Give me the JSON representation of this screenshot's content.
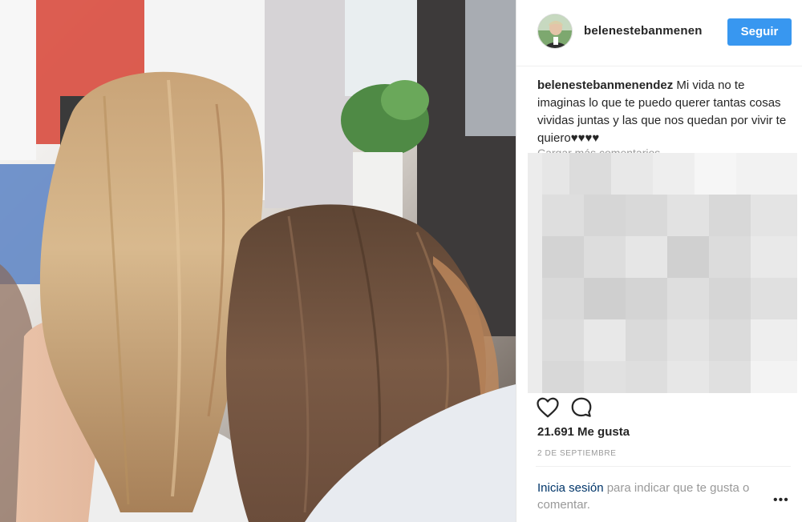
{
  "post": {
    "username": "belenestebanmenen",
    "follow_label": "Seguir",
    "caption_user": "belenestebanmenendez",
    "caption_text": " Mi vida no te imaginas lo que te puedo querer tantas cosas vividas juntas y las que nos quedan por vivir te quiero♥♥♥♥",
    "load_more_label": "Cargar más comentarios",
    "likes": "21.691 Me gusta",
    "date": "2 DE SEPTIEMBRE",
    "login_link": "Inicia sesión",
    "login_rest": " para indicar que te gusta o comentar.",
    "more_options": "•••"
  },
  "icons": {
    "like": "heart-icon",
    "comment": "comment-icon",
    "more": "more-options-icon"
  },
  "colors": {
    "follow_button": "#3897f0",
    "link": "#003569",
    "muted": "#999999",
    "text": "#262626"
  }
}
